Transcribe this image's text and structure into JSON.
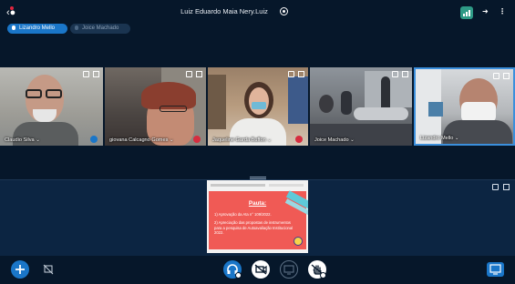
{
  "header": {
    "meeting_title": "Luiz Eduardo Maia Nery.Luiz"
  },
  "talking_indicators": [
    {
      "name": "Lizandro Mello",
      "active": true
    },
    {
      "name": "Joice Machado",
      "active": false
    }
  ],
  "participants": [
    {
      "name": "Claudio Silva",
      "mic": "on",
      "speaking": false
    },
    {
      "name": "giovana Calcagno Gomes",
      "mic": "muted",
      "speaking": false
    },
    {
      "name": "Jaqueline Garda Buffon",
      "mic": "muted",
      "speaking": false
    },
    {
      "name": "Joice Machado",
      "mic": "none",
      "speaking": false
    },
    {
      "name": "Lizandro Mello",
      "mic": "none",
      "speaking": true
    }
  ],
  "presentation": {
    "title": "Pauta:",
    "items": [
      "1) Aprovação da Ata n° 109/2022.",
      "2) Apreciação das propostas de instrumentos para a pesquisa de Autoavaliação Institucional 2022."
    ]
  },
  "colors": {
    "background": "#06172a",
    "accent": "#1a76c8",
    "muted": "#d62d3f",
    "slide": "#f05a55"
  },
  "icons": {
    "actions": "plus-icon",
    "presentation_toggle": "presentation-off-icon",
    "audio": "headphones-icon",
    "video": "video-off-icon",
    "screenshare": "screenshare-icon",
    "raise_hand": "hand-icon",
    "minimize_presentation": "presentation-icon"
  }
}
